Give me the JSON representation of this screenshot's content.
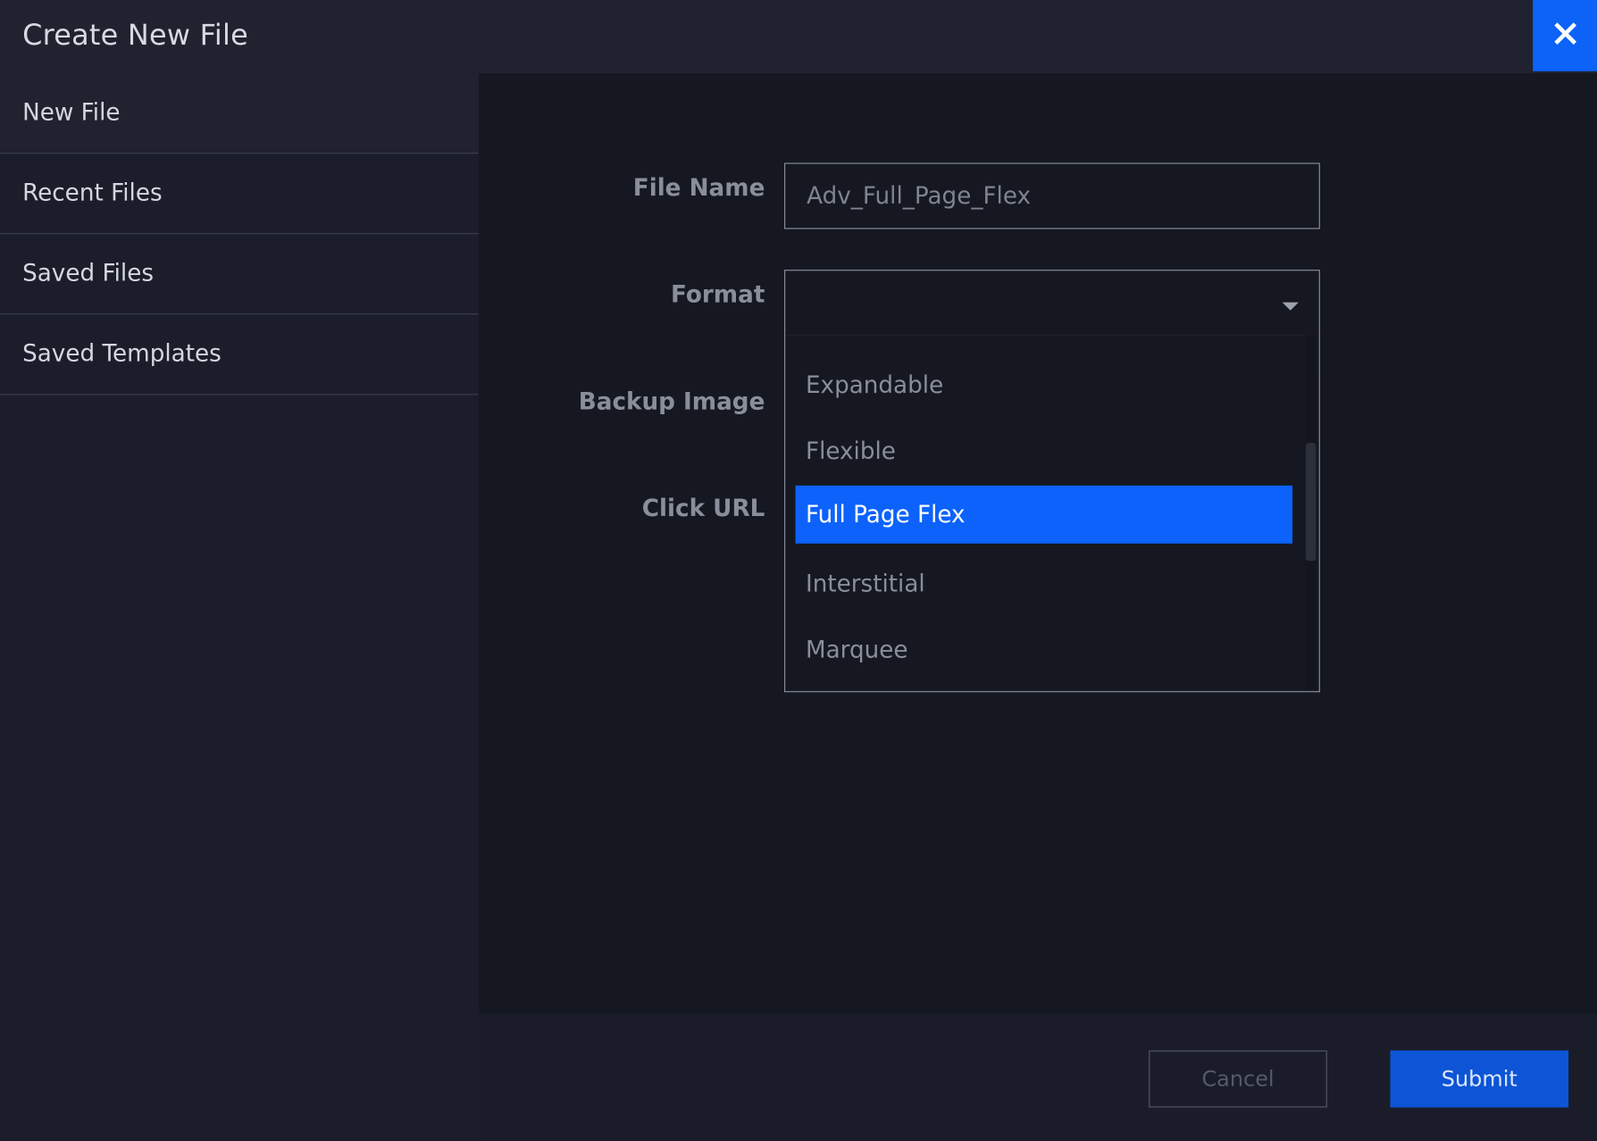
{
  "window": {
    "title": "Create New File",
    "close_icon": "close-icon"
  },
  "sidebar": {
    "items": [
      {
        "label": "New File",
        "active": true
      },
      {
        "label": "Recent Files",
        "active": false
      },
      {
        "label": "Saved Files",
        "active": false
      },
      {
        "label": "Saved Templates",
        "active": false
      }
    ]
  },
  "form": {
    "file_name": {
      "label": "File Name",
      "value": "Adv_Full_Page_Flex"
    },
    "format": {
      "label": "Format",
      "selected": "",
      "dropdown_icon": "chevron-down-icon",
      "options": [
        "Expandable",
        "Flexible",
        "Full Page Flex",
        "Interstitial",
        "Marquee"
      ],
      "highlighted": "Full Page Flex"
    },
    "backup_image": {
      "label": "Backup Image"
    },
    "click_url": {
      "label": "Click URL"
    }
  },
  "footer": {
    "cancel_label": "Cancel",
    "submit_label": "Submit"
  },
  "colors": {
    "accent": "#0d63f8",
    "background": "#1a1d29",
    "panel": "#151821"
  }
}
